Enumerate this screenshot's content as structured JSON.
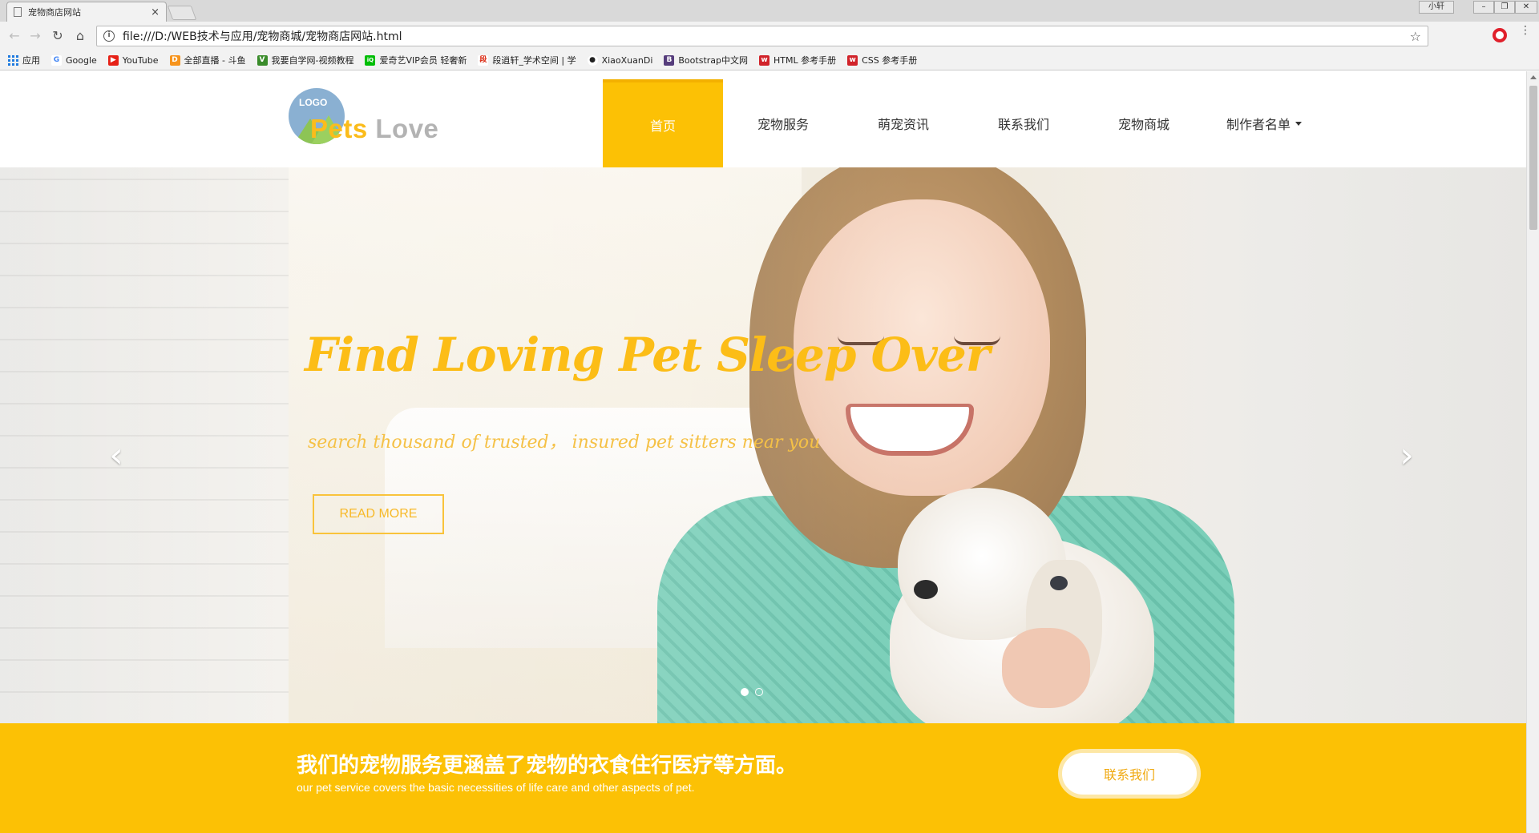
{
  "browser": {
    "tab_title": "宠物商店网站",
    "tab_close": "×",
    "url": "file:///D:/WEB技术与应用/宠物商城/宠物商店网站.html",
    "user_label": "小轩",
    "bookmarks": [
      {
        "label": "应用",
        "icon": "apps-grid-icon"
      },
      {
        "label": "Google",
        "icon": "google-icon",
        "color": "#4285f4",
        "glyph": "G"
      },
      {
        "label": "YouTube",
        "icon": "youtube-icon",
        "color": "#e62117",
        "glyph": "▶"
      },
      {
        "label": "全部直播 - 斗鱼",
        "icon": "douyu-icon",
        "color": "#f7941d",
        "glyph": "D"
      },
      {
        "label": "我要自学网-视频教程",
        "icon": "zixue-icon",
        "color": "#3a8c2b",
        "glyph": "V"
      },
      {
        "label": "爱奇艺VIP会员 轻奢新",
        "icon": "iqiyi-icon",
        "color": "#00be06",
        "glyph": "iQ"
      },
      {
        "label": "段逍轩_学术空间 | 学",
        "icon": "space-icon",
        "color": "#d81e06",
        "glyph": "段"
      },
      {
        "label": "XiaoXuanDi",
        "icon": "github-icon",
        "color": "#222222",
        "glyph": "●"
      },
      {
        "label": "Bootstrap中文网",
        "icon": "bootstrap-icon",
        "color": "#563d7c",
        "glyph": "B"
      },
      {
        "label": "HTML 参考手册",
        "icon": "w3school-icon",
        "color": "#d1232a",
        "glyph": "w"
      },
      {
        "label": "CSS 参考手册",
        "icon": "w3school-icon",
        "color": "#d1232a",
        "glyph": "w"
      }
    ]
  },
  "site": {
    "logo_mark": "LOGO",
    "logo_word1": "Pets",
    "logo_word2": "Love",
    "nav": [
      {
        "label": "首页",
        "active": true
      },
      {
        "label": "宠物服务"
      },
      {
        "label": "萌宠资讯"
      },
      {
        "label": "联系我们"
      },
      {
        "label": "宠物商城"
      },
      {
        "label": "制作者名单",
        "dropdown": true
      }
    ]
  },
  "hero": {
    "title": "Find Loving Pet Sleep Over",
    "subtitle": "search thousand of trusted， insured pet sitters near you",
    "button": "READ MORE",
    "prev_glyph": "‹",
    "next_glyph": "›",
    "slide_count": 2,
    "active_slide": 1
  },
  "promo": {
    "title": "我们的宠物服务更涵盖了宠物的衣食住行医疗等方面。",
    "subtitle": "our pet service covers the basic necessities of life care and other aspects of pet.",
    "button": "联系我们"
  },
  "colors": {
    "accent": "#fcc105",
    "hero_text": "#fcbd17"
  }
}
